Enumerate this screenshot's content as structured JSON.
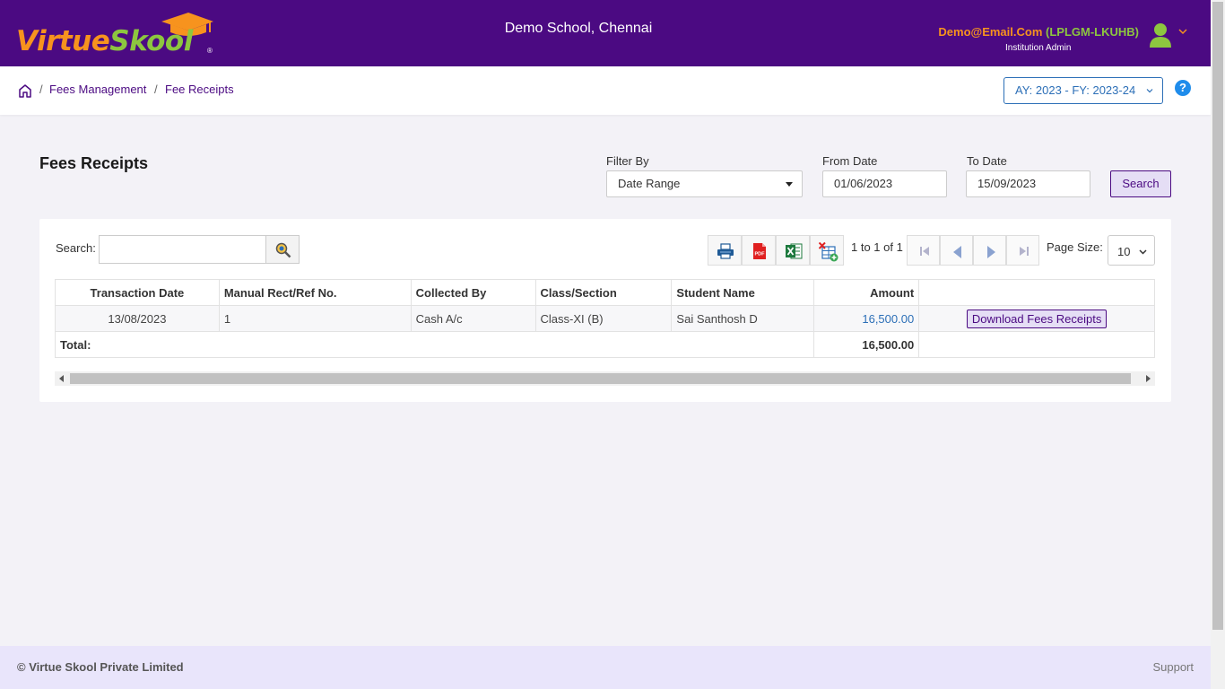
{
  "header": {
    "logo_part1": "Virtue",
    "logo_part2": "Skool",
    "logo_reg": "®",
    "school_name": "Demo School, Chennai",
    "user_email": "Demo@Email.Com",
    "user_code": "(LPLGM-LKUHB)",
    "user_role": "Institution Admin"
  },
  "breadcrumb": {
    "items": [
      "Fees Management",
      "Fee Receipts"
    ],
    "separator": "/"
  },
  "academic_year": "AY: 2023 - FY: 2023-24",
  "help": "?",
  "page": {
    "title": "Fees Receipts",
    "filter_label": "Filter By",
    "filter_value": "Date Range",
    "from_label": "From Date",
    "from_value": "01/06/2023",
    "to_label": "To Date",
    "to_value": "15/09/2023",
    "search_button": "Search"
  },
  "grid": {
    "search_label": "Search:",
    "search_value": "",
    "paging_text": "1 to 1 of 1",
    "page_size_label": "Page Size:",
    "page_size": "10",
    "pdf_label": "PDF",
    "columns": [
      "Transaction Date",
      "Manual Rect/Ref No.",
      "Collected By",
      "Class/Section",
      "Student Name",
      "Amount",
      ""
    ],
    "rows": [
      {
        "date": "13/08/2023",
        "ref": "1",
        "collected_by": "Cash A/c",
        "class_section": "Class-XI (B)",
        "student": "Sai Santhosh D",
        "amount": "16,500.00",
        "action": "Download Fees Receipts"
      }
    ],
    "total_label": "Total:",
    "total_amount": "16,500.00"
  },
  "footer": {
    "copyright": "© Virtue Skool Private Limited",
    "support": "Support"
  },
  "colors": {
    "brand_purple": "#4b0a82",
    "logo_orange": "#f7931e",
    "logo_green": "#8dc63f",
    "link_blue": "#2c6fb7",
    "footer_bg": "#e9e5fb"
  }
}
